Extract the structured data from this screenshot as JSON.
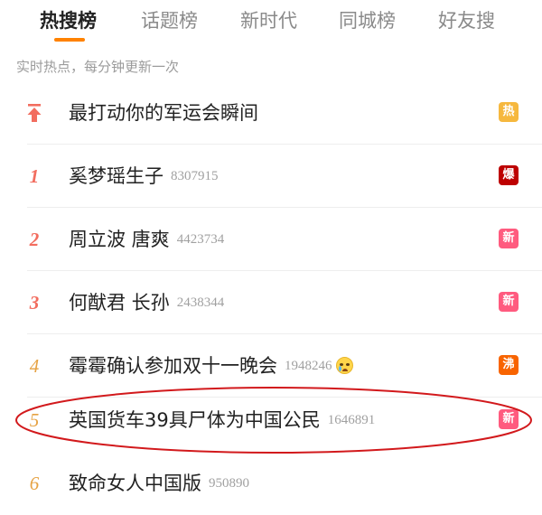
{
  "tabs": [
    {
      "label": "热搜榜",
      "active": true
    },
    {
      "label": "话题榜",
      "active": false
    },
    {
      "label": "新时代",
      "active": false
    },
    {
      "label": "同城榜",
      "active": false
    },
    {
      "label": "好友搜",
      "active": false
    }
  ],
  "subtitle": "实时热点，每分钟更新一次",
  "items": [
    {
      "rank": "",
      "rank_icon": "pin-up-arrow-icon",
      "title": "最打动你的军运会瞬间",
      "heat": "",
      "badge": "热",
      "badge_color": "#f6b83e"
    },
    {
      "rank": "1",
      "title": "奚梦瑶生子",
      "heat": "8307915",
      "badge": "爆",
      "badge_color": "#bd0000"
    },
    {
      "rank": "2",
      "title": "周立波 唐爽",
      "heat": "4423734",
      "badge": "新",
      "badge_color": "#ff5b7f"
    },
    {
      "rank": "3",
      "title": "何猷君 长孙",
      "heat": "2438344",
      "badge": "新",
      "badge_color": "#ff5b7f"
    },
    {
      "rank": "4",
      "title": "霉霉确认参加双十一晚会",
      "heat": "1948246",
      "emoji": "crying-face-icon",
      "badge": "沸",
      "badge_color": "#f86400"
    },
    {
      "rank": "5",
      "title": "英国货车39具尸体为中国公民",
      "heat": "1646891",
      "badge": "新",
      "badge_color": "#ff5b7f",
      "circled": true
    },
    {
      "rank": "6",
      "title": "致命女人中国版",
      "heat": "950890",
      "badge": "",
      "badge_color": ""
    }
  ],
  "colors": {
    "accent": "#ff8200",
    "rank_top": "#f26d5f",
    "rank_mid": "#e6a243",
    "annotation": "#d2191c"
  }
}
